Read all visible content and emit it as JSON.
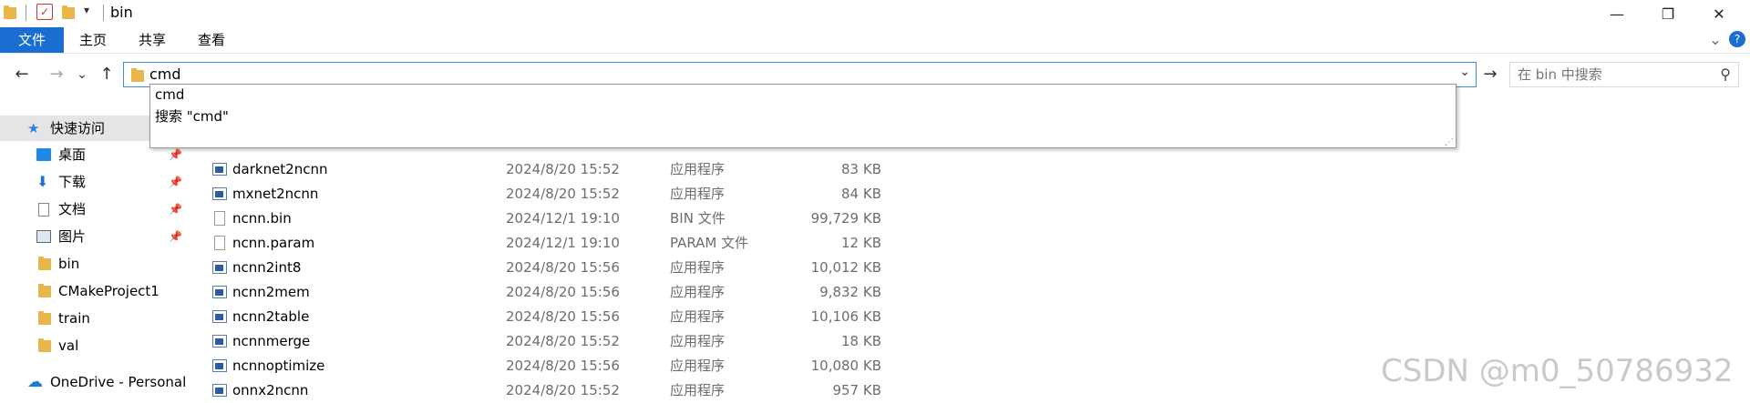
{
  "window": {
    "title": "bin",
    "minimize_glyph": "—",
    "maximize_glyph": "❐",
    "close_glyph": "✕"
  },
  "ribbon": {
    "tabs": [
      "文件",
      "主页",
      "共享",
      "查看"
    ],
    "collapse_glyph": "⌄",
    "help_glyph": "?"
  },
  "nav": {
    "back_glyph": "←",
    "forward_glyph": "→",
    "recent_glyph": "⌄",
    "up_glyph": "↑",
    "go_glyph": "→"
  },
  "address": {
    "value": "cmd",
    "dropdown_glyph": "⌄"
  },
  "search": {
    "placeholder": "在 bin 中搜索",
    "icon": "search-icon"
  },
  "autocomplete": {
    "items": [
      "cmd",
      "搜索 \"cmd\""
    ]
  },
  "sidebar": {
    "items": [
      {
        "label": "快速访问",
        "icon": "star-icon"
      },
      {
        "label": "桌面",
        "icon": "desktop-icon",
        "pinned": true
      },
      {
        "label": "下载",
        "icon": "download-icon",
        "pinned": true
      },
      {
        "label": "文档",
        "icon": "document-icon",
        "pinned": true
      },
      {
        "label": "图片",
        "icon": "picture-icon",
        "pinned": true
      },
      {
        "label": "bin",
        "icon": "folder-icon"
      },
      {
        "label": "CMakeProject1",
        "icon": "folder-icon"
      },
      {
        "label": "train",
        "icon": "folder-icon"
      },
      {
        "label": "val",
        "icon": "folder-icon"
      },
      {
        "label": "OneDrive - Personal",
        "icon": "cloud-icon"
      }
    ]
  },
  "files": [
    {
      "name": "darknet2ncnn",
      "date": "2024/8/20 15:52",
      "type": "应用程序",
      "size": "83 KB",
      "icon": "exe-icon"
    },
    {
      "name": "mxnet2ncnn",
      "date": "2024/8/20 15:52",
      "type": "应用程序",
      "size": "84 KB",
      "icon": "exe-icon"
    },
    {
      "name": "ncnn.bin",
      "date": "2024/12/1 19:10",
      "type": "BIN 文件",
      "size": "99,729 KB",
      "icon": "file-icon"
    },
    {
      "name": "ncnn.param",
      "date": "2024/12/1 19:10",
      "type": "PARAM 文件",
      "size": "12 KB",
      "icon": "file-icon"
    },
    {
      "name": "ncnn2int8",
      "date": "2024/8/20 15:56",
      "type": "应用程序",
      "size": "10,012 KB",
      "icon": "exe-icon"
    },
    {
      "name": "ncnn2mem",
      "date": "2024/8/20 15:56",
      "type": "应用程序",
      "size": "9,832 KB",
      "icon": "exe-icon"
    },
    {
      "name": "ncnn2table",
      "date": "2024/8/20 15:56",
      "type": "应用程序",
      "size": "10,106 KB",
      "icon": "exe-icon"
    },
    {
      "name": "ncnnmerge",
      "date": "2024/8/20 15:52",
      "type": "应用程序",
      "size": "18 KB",
      "icon": "exe-icon"
    },
    {
      "name": "ncnnoptimize",
      "date": "2024/8/20 15:56",
      "type": "应用程序",
      "size": "10,080 KB",
      "icon": "exe-icon"
    },
    {
      "name": "onnx2ncnn",
      "date": "2024/8/20 15:52",
      "type": "应用程序",
      "size": "957 KB",
      "icon": "exe-icon"
    }
  ],
  "watermark": "CSDN @m0_50786932",
  "colors": {
    "accent": "#1a6dd1",
    "address_border": "#3b8be0",
    "folder": "#e8b64a"
  }
}
